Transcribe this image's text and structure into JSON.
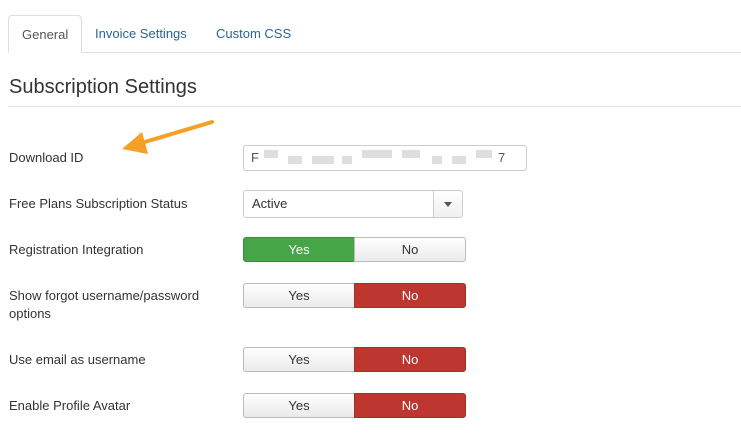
{
  "tabs": [
    {
      "label": "General",
      "active": true
    },
    {
      "label": "Invoice Settings",
      "active": false
    },
    {
      "label": "Custom CSS",
      "active": false
    }
  ],
  "section_title": "Subscription Settings",
  "fields": {
    "download_id": {
      "label": "Download ID",
      "value_start": "F",
      "value_end": "7"
    },
    "free_plans_status": {
      "label": "Free Plans Subscription Status",
      "value": "Active"
    },
    "registration_integration": {
      "label": "Registration Integration",
      "yes": "Yes",
      "no": "No",
      "selected": "Yes"
    },
    "show_forgot": {
      "label": "Show forgot username/password options",
      "yes": "Yes",
      "no": "No",
      "selected": "No"
    },
    "use_email": {
      "label": "Use email as username",
      "yes": "Yes",
      "no": "No",
      "selected": "No"
    },
    "profile_avatar": {
      "label": "Enable Profile Avatar",
      "yes": "Yes",
      "no": "No",
      "selected": "No"
    }
  },
  "colors": {
    "yes_active": "#46a546",
    "no_active": "#bd362f",
    "link": "#2a6496",
    "annotation_arrow": "#f5a024"
  },
  "icons": {
    "select_caret": "chevron-down-icon",
    "annotation": "arrow-annotation-icon"
  }
}
